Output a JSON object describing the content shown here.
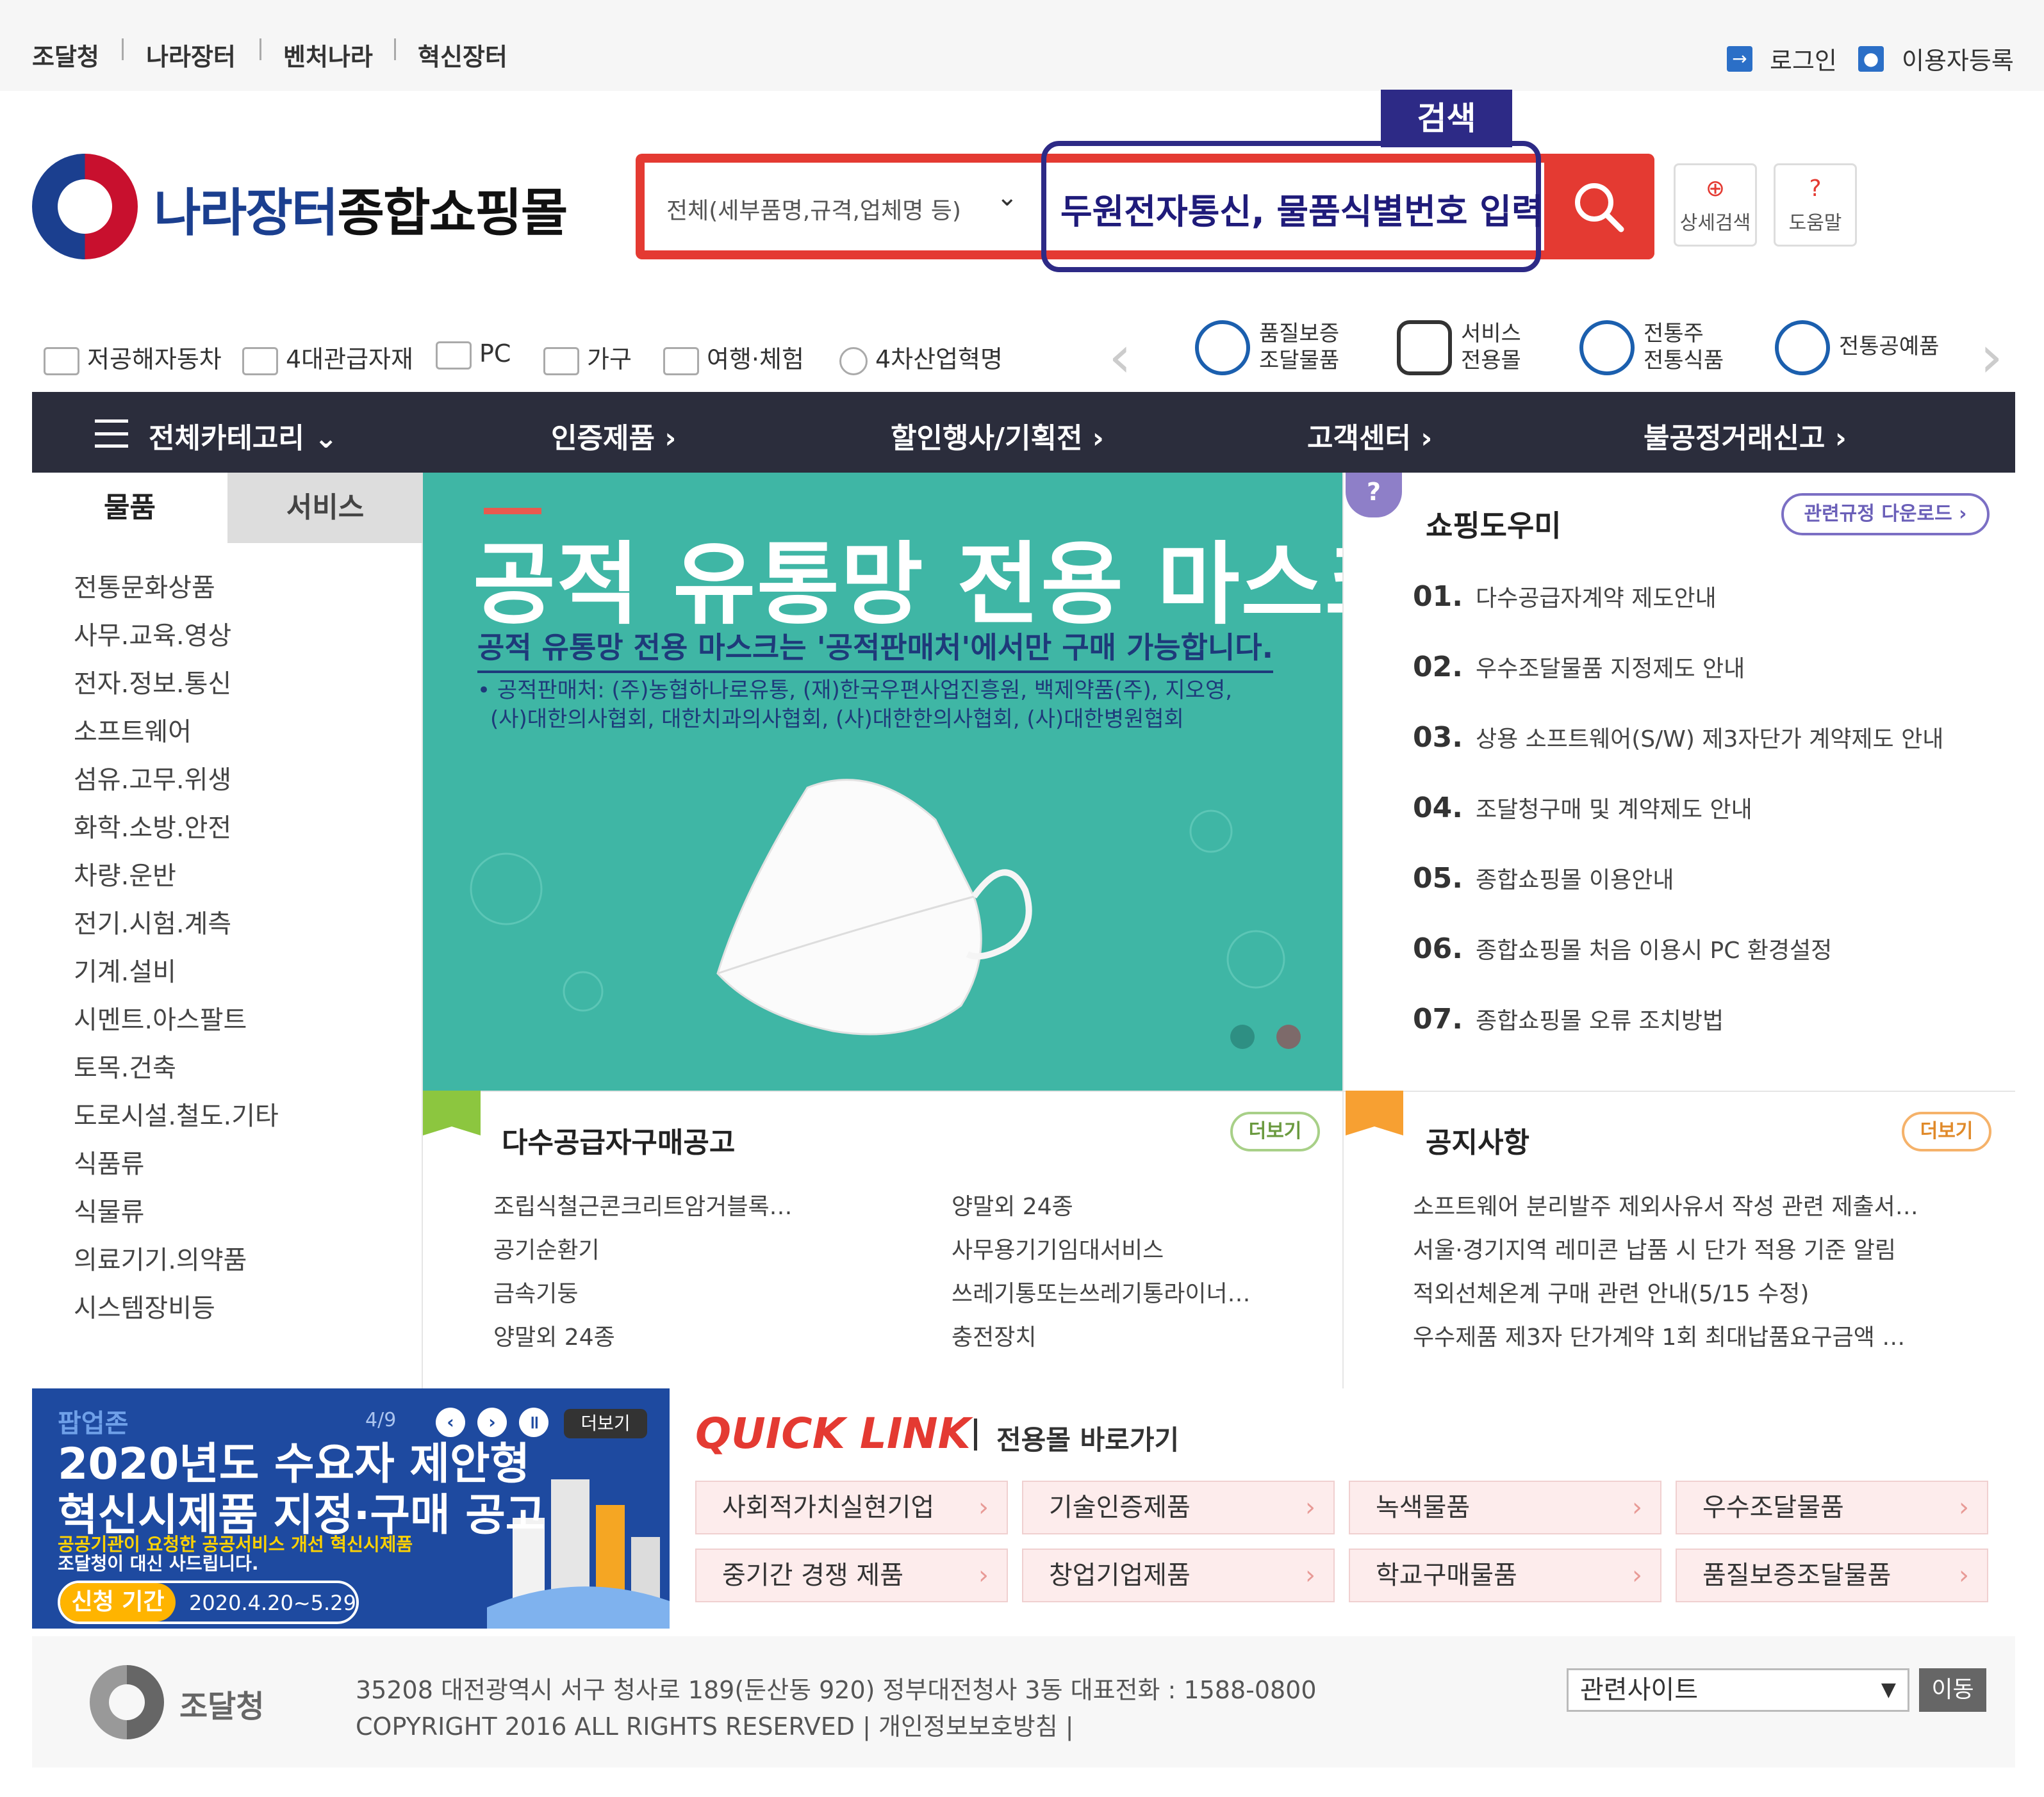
{
  "top_links": [
    "조달청",
    "나라장터",
    "벤처나라",
    "혁신장터"
  ],
  "user_links": {
    "login": "로그인",
    "register": "이용자등록"
  },
  "logo": {
    "main": "나라장터",
    "accent": "종합쇼핑몰"
  },
  "search": {
    "tag": "검색",
    "scope": "전체(세부품명,규격,업체명 등)",
    "input_value": "두원전자통신, 물품식별번호 입력",
    "detail_label": "상세검색",
    "help_label": "도움말"
  },
  "quick_categories": [
    "저공해자동차",
    "4대관급자재",
    "PC",
    "가구",
    "여행·체험",
    "4차산업혁명"
  ],
  "special_malls": [
    {
      "line1": "품질보증",
      "line2": "조달물품"
    },
    {
      "line1": "서비스",
      "line2": "전용몰"
    },
    {
      "line1": "전통주",
      "line2": "전통식품"
    },
    {
      "line1": "전통공예품",
      "line2": ""
    }
  ],
  "main_nav": [
    "전체카테고리",
    "인증제품",
    "할인행사/기획전",
    "고객센터",
    "불공정거래신고"
  ],
  "left_tabs": {
    "goods": "물품",
    "services": "서비스"
  },
  "categories": [
    "전통문화상품",
    "사무.교육.영상",
    "전자.정보.통신",
    "소프트웨어",
    "섬유.고무.위생",
    "화학.소방.안전",
    "차량.운반",
    "전기.시험.계측",
    "기계.설비",
    "시멘트.아스팔트",
    "토목.건축",
    "도로시설.철도.기타",
    "식품류",
    "식물류",
    "의료기기.의약품",
    "시스템장비등"
  ],
  "banner": {
    "title": "공적 유통망 전용 마스크",
    "subtitle": "공적 유통망 전용 마스크는 '공적판매처'에서만 구매 가능합니다.",
    "note1": "• 공적판매처: (주)농협하나로유통, (재)한국우편사업진흥원, 백제약품(주), 지오영,",
    "note2": "(사)대한의사협회, 대한치과의사협회, (사)대한한의사협회, (사)대한병원협회"
  },
  "helper": {
    "title": "쇼핑도우미",
    "download": "관련규정 다운로드 ›",
    "items": [
      {
        "num": "01.",
        "text": "다수공급자계약 제도안내"
      },
      {
        "num": "02.",
        "text": "우수조달물품 지정제도 안내"
      },
      {
        "num": "03.",
        "text": "상용 소프트웨어(S/W) 제3자단가 계약제도 안내"
      },
      {
        "num": "04.",
        "text": "조달청구매 및 계약제도 안내"
      },
      {
        "num": "05.",
        "text": "종합쇼핑몰 이용안내"
      },
      {
        "num": "06.",
        "text": "종합쇼핑몰 처음 이용시 PC 환경설정"
      },
      {
        "num": "07.",
        "text": "종합쇼핑몰 오류 조치방법"
      }
    ]
  },
  "multi_supplier": {
    "title": "다수공급자구매공고",
    "more": "더보기",
    "col1": [
      "조립식철근콘크리트암거블록…",
      "공기순환기",
      "금속기둥",
      "양말외 24종"
    ],
    "col2": [
      "양말외 24종",
      "사무용기기임대서비스",
      "쓰레기통또는쓰레기통라이너…",
      "충전장치"
    ]
  },
  "notice": {
    "title": "공지사항",
    "more": "더보기",
    "items": [
      "소프트웨어 분리발주 제외사유서 작성 관련 제출서…",
      "서울·경기지역 레미콘 납품 시 단가 적용 기준 알림",
      "적외선체온계 구매 관련 안내(5/15 수정)",
      "우수제품 제3자 단가계약 1회 최대납품요구금액 …"
    ]
  },
  "popup": {
    "label": "팝업존",
    "counter": "4/9",
    "more": "더보기",
    "title1": "2020년도 수요자 제안형",
    "title2": "혁신시제품 지정·구매 공고",
    "sub1": "공공기관이 요청한 공공서비스 개선 혁신시제품",
    "sub2": "조달청이 대신 사드립니다.",
    "period_label": "신청 기간",
    "period": "2020.4.20~5.29"
  },
  "quick_link": {
    "title": "QUICK LINK",
    "subtitle": "전용몰 바로가기",
    "items": [
      "사회적가치실현기업",
      "기술인증제품",
      "녹색물품",
      "우수조달물품",
      "중기간 경쟁 제품",
      "창업기업제품",
      "학교구매물품",
      "품질보증조달물품"
    ]
  },
  "footer": {
    "logo": "조달청",
    "address": "35208 대전광역시 서구 청사로 189(둔산동 920) 정부대전청사 3동 대표전화 : 1588-0800",
    "copyright": "COPYRIGHT 2016 ALL RIGHTS RESERVED | 개인정보보호방침 |",
    "related_sites": "관련사이트",
    "go": "이동"
  },
  "colors": {
    "brand_red": "#e43a32",
    "brand_navy": "#2d2a86",
    "nav_dark": "#2b2d3c",
    "banner_teal": "#3fb6a5"
  }
}
